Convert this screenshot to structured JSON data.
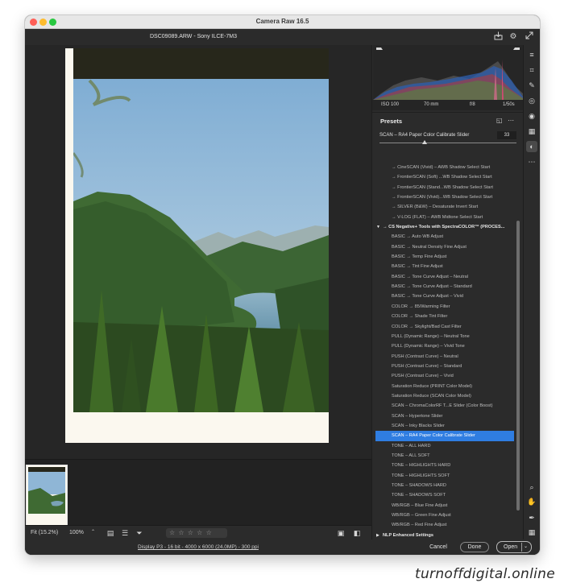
{
  "window": {
    "title": "Camera Raw 16.5"
  },
  "file": {
    "title": "DSC09089.ARW  -  Sony ILCE-7M3"
  },
  "histogram": {
    "iso": "ISO 100",
    "focal": "70 mm",
    "aperture": "f/8",
    "shutter": "1/50s"
  },
  "presets": {
    "title": "Presets",
    "amount_label": "SCAN – RA4 Paper Color Calibrate Slider",
    "amount_value": "33",
    "amount_fraction": 0.33,
    "items": [
      {
        "label": "→ CineSCAN (Vivid) – AWB Shadow Select Start",
        "kind": "sub"
      },
      {
        "label": "→ FrontierSCAN (Soft) ...WB Shadow Select Start",
        "kind": "sub"
      },
      {
        "label": "→ FrontierSCAN (Stand...WB Shadow Select Start",
        "kind": "sub"
      },
      {
        "label": "→ FrontierSCAN (Vivid)...WB Shadow Select Start",
        "kind": "sub"
      },
      {
        "label": "→ SILVER (B&W) – Desaturate Invert Start",
        "kind": "sub"
      },
      {
        "label": "→ V-LOG (FLAT) – AWB Midtone Select Start",
        "kind": "sub"
      },
      {
        "label": "→ CS Negative+ Tools with SpectraCOLOR™ (PROCES...",
        "kind": "group"
      },
      {
        "label": "BASIC → Auto WB Adjust",
        "kind": "item"
      },
      {
        "label": "BASIC → Neutral Density Fine Adjust",
        "kind": "item"
      },
      {
        "label": "BASIC → Temp Fine Adjust",
        "kind": "item"
      },
      {
        "label": "BASIC → Tint Fine Adjust",
        "kind": "item"
      },
      {
        "label": "BASIC → Tone Curve Adjust – Neutral",
        "kind": "item"
      },
      {
        "label": "BASIC → Tone Curve Adjust – Standard",
        "kind": "item"
      },
      {
        "label": "BASIC → Tone Curve Adjust – Vivid",
        "kind": "item"
      },
      {
        "label": "COLOR → 85/Warming Filter",
        "kind": "item"
      },
      {
        "label": "COLOR → Shade Tint Filter",
        "kind": "item"
      },
      {
        "label": "COLOR → Skylight/Bad Cast Filter",
        "kind": "item"
      },
      {
        "label": "PULL (Dynamic Range) – Neutral Tone",
        "kind": "item"
      },
      {
        "label": "PULL (Dynamic Range) – Vivid Tone",
        "kind": "item"
      },
      {
        "label": "PUSH (Contrast Curve) – Neutral",
        "kind": "item"
      },
      {
        "label": "PUSH (Contrast Curve) – Standard",
        "kind": "item"
      },
      {
        "label": "PUSH (Contrast Curve) – Vivid",
        "kind": "item"
      },
      {
        "label": "Saturation Reduce (PRINT Color Model)",
        "kind": "item"
      },
      {
        "label": "Saturation Reduce (SCAN Color Model)",
        "kind": "item"
      },
      {
        "label": "SCAN – ChromaColorRF T...E Slider (Color Boost)",
        "kind": "item"
      },
      {
        "label": "SCAN – Hypertone Slider",
        "kind": "item"
      },
      {
        "label": "SCAN – Inky Blacks Slider",
        "kind": "item"
      },
      {
        "label": "SCAN – RA4 Paper Color Calibrate Slider",
        "kind": "selected"
      },
      {
        "label": "TONE – ALL HARD",
        "kind": "item"
      },
      {
        "label": "TONE – ALL SOFT",
        "kind": "item"
      },
      {
        "label": "TONE – HIGHLIGHTS HARD",
        "kind": "item"
      },
      {
        "label": "TONE – HIGHLIGHTS SOFT",
        "kind": "item"
      },
      {
        "label": "TONE – SHADOWS HARD",
        "kind": "item"
      },
      {
        "label": "TONE – SHADOWS SOFT",
        "kind": "item"
      },
      {
        "label": "WB/RGB – Blue Fine Adjust",
        "kind": "item"
      },
      {
        "label": "WB/RGB – Green Fine Adjust",
        "kind": "item"
      },
      {
        "label": "WB/RGB – Red Fine Adjust",
        "kind": "item"
      },
      {
        "label": "NLP Enhanced Settings",
        "kind": "group-collapsed"
      }
    ]
  },
  "canvas_toolbar": {
    "zoom_fit": "Fit (15.2%)",
    "zoom_100": "100%",
    "rating_stars": "☆ ☆ ☆ ☆ ☆"
  },
  "status": {
    "workflow_link": "Display P3 - 16 bit - 4000 x 6000 (24.0MP) - 300 ppi",
    "cancel": "Cancel",
    "done": "Done",
    "open": "Open"
  },
  "icons": {
    "save": "save-icon",
    "settings": "gear-icon",
    "fullscreen": "expand-icon"
  },
  "colors": {
    "selection": "#2f7de1",
    "panel_bg": "#2b2b2b",
    "canvas_bg": "#262626"
  },
  "watermark": "turnoffdigital.online"
}
